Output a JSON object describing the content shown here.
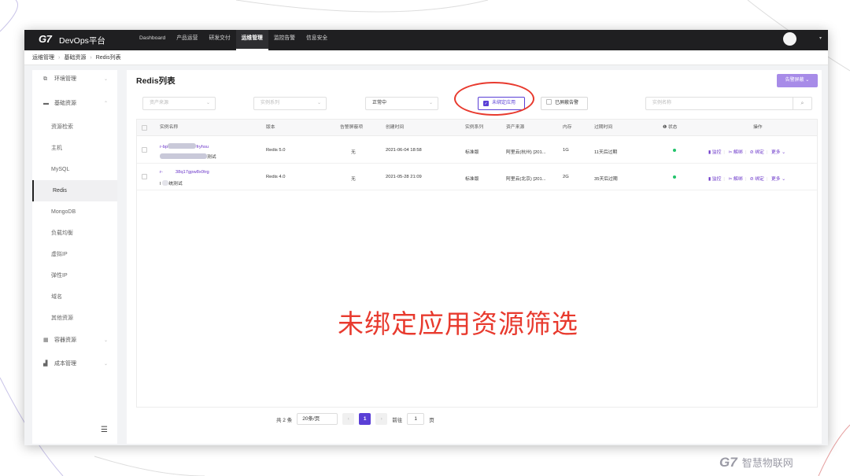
{
  "app": {
    "logo": "G7",
    "title": "DevOps平台",
    "avatar_caret": "▾"
  },
  "nav": [
    {
      "label": "Dashboard"
    },
    {
      "label": "产品运营"
    },
    {
      "label": "研发交付"
    },
    {
      "label": "运维管理"
    },
    {
      "label": "监控告警"
    },
    {
      "label": "信息安全"
    }
  ],
  "breadcrumb": [
    "运维管理",
    "基础资源",
    "Redis列表"
  ],
  "sidebar": {
    "env": "环境管理",
    "base": "基础资源",
    "sub": [
      "资源检索",
      "主机",
      "MySQL",
      "Redis",
      "MongoDB",
      "负载均衡",
      "虚拟IP",
      "弹性IP",
      "域名",
      "其他资源"
    ],
    "container": "容器资源",
    "cost": "成本管理",
    "collapse_icon": "☰"
  },
  "main": {
    "title": "Redis列表",
    "alarm_button": "告警屏蔽 ⌄",
    "filters": {
      "source": "资产来源",
      "series": "实例系列",
      "status": "正常中",
      "unbound": "未绑定应用",
      "unbound_checked": true,
      "shielded": "已屏蔽告警",
      "shielded_checked": false,
      "search_placeholder": "实例名称"
    }
  },
  "table": {
    "headers": [
      "实例名称",
      "版本",
      "告警屏蔽项",
      "创建时间",
      "实例系列",
      "资产来源",
      "内存",
      "过期时间",
      "状态",
      "操作"
    ],
    "rows": [
      {
        "name_pre": "r-bp",
        "name_post": "fryhsu",
        "desc": "测试",
        "version": "Redis 5.0",
        "shield": "无",
        "created": "2021-06-04 18:58",
        "series": "标准版",
        "source": "阿里云(杭州) [201...",
        "memory": "1G",
        "expire": "11天后过期"
      },
      {
        "name_pre": "r-",
        "name_post": "38q17gpw8x0trg",
        "desc": "统测试",
        "desc_pre": "I",
        "version": "Redis 4.0",
        "shield": "无",
        "created": "2021-05-28 21:09",
        "series": "标准版",
        "source": "阿里云(北京) [201...",
        "memory": "2G",
        "expire": "35天后过期"
      }
    ],
    "ops": {
      "monitor": "监控",
      "unbind": "解绑",
      "bind": "绑定",
      "more": "更多 ⌄"
    }
  },
  "pager": {
    "total": "共 2 条",
    "size": "20条/页",
    "current": "1",
    "goto": "前往",
    "goto_val": "1",
    "page_unit": "页",
    "prev": "‹",
    "next": "›"
  },
  "caption": "未绑定应用资源筛选",
  "brand": {
    "logo": "G7",
    "name": "智慧物联网"
  },
  "colors": {
    "accent": "#5a3fd6",
    "annotation": "#e83a2e",
    "status_ok": "#22c36b"
  }
}
